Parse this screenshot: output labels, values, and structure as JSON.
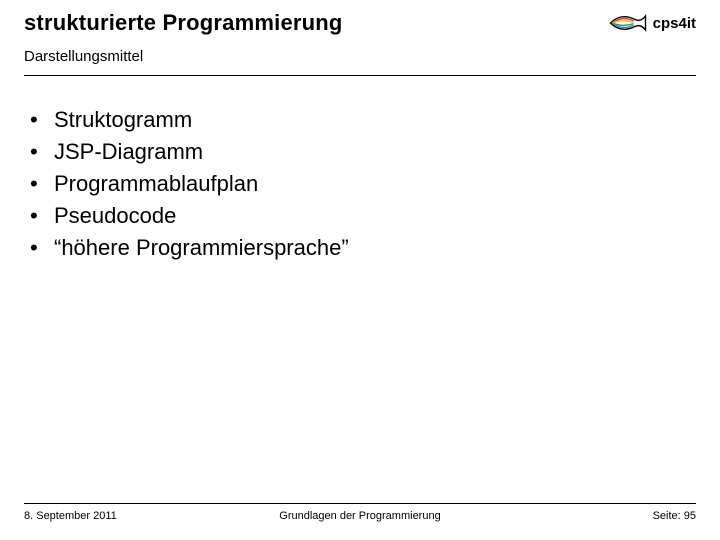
{
  "header": {
    "title": "strukturierte Programmierung",
    "subtitle": "Darstellungsmittel",
    "logo_text": "cps4it"
  },
  "bullets": [
    "Struktogramm",
    "JSP-Diagramm",
    "Programmablaufplan",
    "Pseudocode",
    "“höhere Programmiersprache”"
  ],
  "footer": {
    "date": "8. September 2011",
    "center": "Grundlagen der Programmierung",
    "page_label": "Seite: 95"
  }
}
